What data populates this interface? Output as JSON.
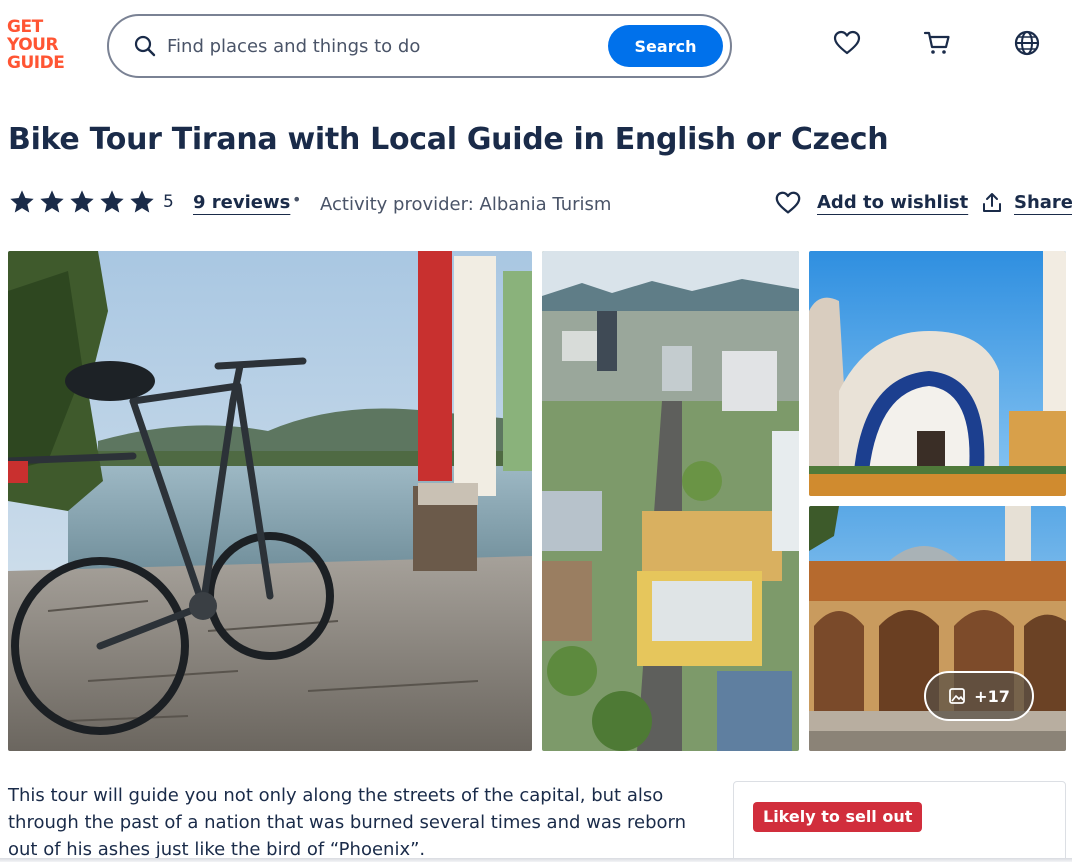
{
  "header": {
    "logo_lines": [
      "GET",
      "YOUR",
      "GUIDE"
    ],
    "search_placeholder": "Find places and things to do",
    "search_button": "Search",
    "icons": [
      "heart-icon",
      "cart-icon",
      "globe-icon"
    ]
  },
  "activity": {
    "title": "Bike Tour Tirana with Local Guide in English or Czech",
    "rating_value": "5",
    "reviews_label": "9 reviews",
    "separator": "•",
    "provider": "Activity provider: Albania Turism",
    "wishlist_label": "Add to wishlist",
    "share_label": "Share"
  },
  "gallery": {
    "more_count": "+17",
    "photos": [
      "bike by the lake",
      "aerial city view",
      "cathedral",
      "mosque"
    ]
  },
  "description": {
    "text": "This tour will guide you not only along the streets of the capital, but also through the past of a nation that was burned several times and was reborn out of his ashes just like the bird of “Phoenix”."
  },
  "booking": {
    "badge": "Likely to sell out"
  },
  "colors": {
    "brand": "#ff5533",
    "primary": "#0071eb",
    "text": "#1a2b49",
    "badge": "#d12e3c"
  }
}
